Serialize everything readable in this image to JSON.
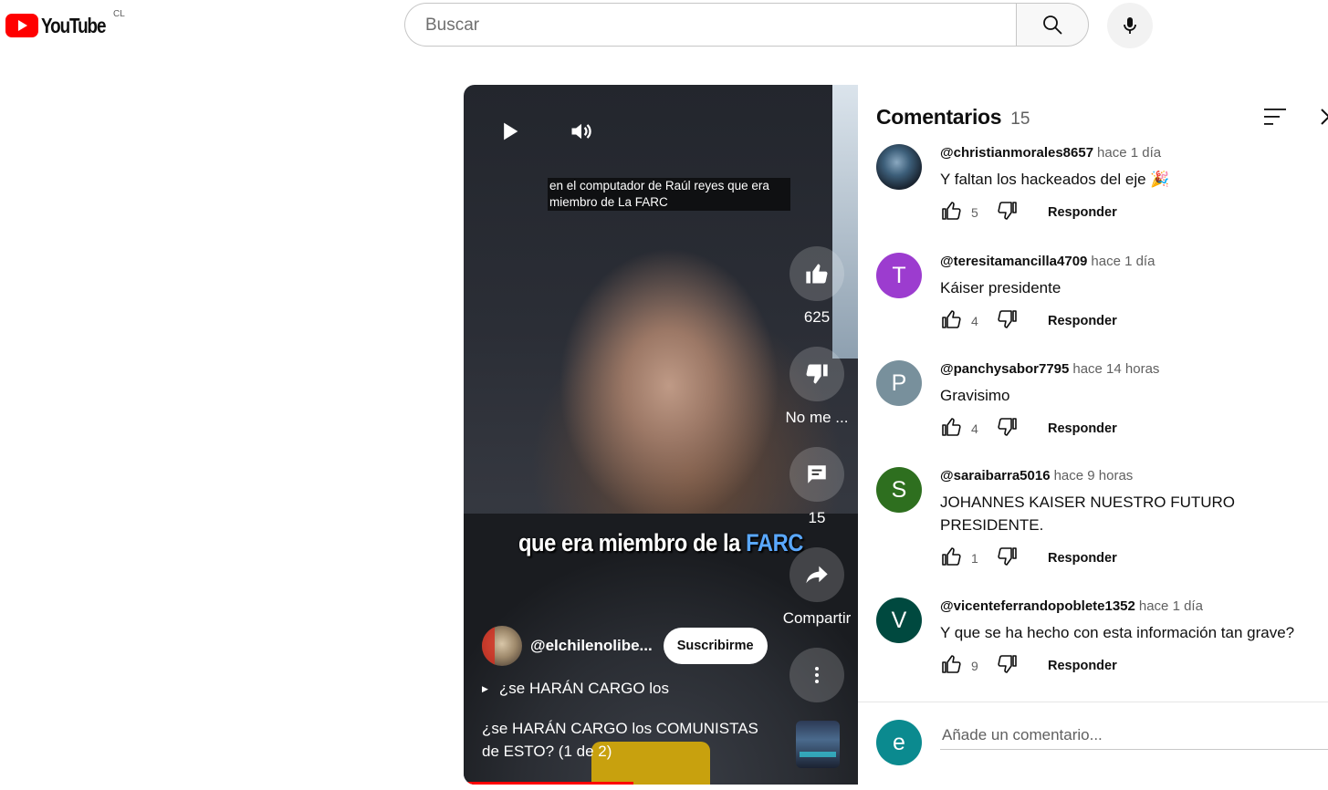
{
  "masthead": {
    "logo_text": "YouTube",
    "country_code": "CL",
    "search_placeholder": "Buscar",
    "search_icon": "search-icon",
    "mic_icon": "mic-icon"
  },
  "video": {
    "caption_small": "en el computador de Raúl reyes que era miembro de La FARC",
    "caption_big_prefix": "que era miembro de la ",
    "caption_big_highlight": "FARC",
    "like_count": "625",
    "dislike_label": "No me ...",
    "comment_count": "15",
    "share_label": "Compartir",
    "channel_handle": "@elchilenolibe...",
    "subscribe_label": "Suscribirme",
    "playlist_label": "¿se HARÁN CARGO los",
    "title": "¿se HARÁN CARGO los COMUNISTAS de ESTO? (1 de 2)",
    "progress_fraction": 0.43
  },
  "comments_panel": {
    "title": "Comentarios",
    "count": "15",
    "reply_label": "Responder",
    "add_placeholder": "Añade un comentario...",
    "user_initial": "e",
    "items": [
      {
        "author": "@christianmorales8657",
        "time": "hace 1 día",
        "text": "Y faltan los hackeados del eje 🎉",
        "likes": "5",
        "initial": "",
        "color": "#1b2633"
      },
      {
        "author": "@teresitamancilla4709",
        "time": "hace 1 día",
        "text": "Káiser presidente",
        "likes": "4",
        "initial": "T",
        "color": "#9c3ccf"
      },
      {
        "author": "@panchysabor7795",
        "time": "hace 14 horas",
        "text": "Gravisimo",
        "likes": "4",
        "initial": "P",
        "color": "#78909c"
      },
      {
        "author": "@saraibarra5016",
        "time": "hace 9 horas",
        "text": "JOHANNES KAISER NUESTRO FUTURO PRESIDENTE.",
        "likes": "1",
        "initial": "S",
        "color": "#2e6f1f"
      },
      {
        "author": "@vicenteferrandopoblete1352",
        "time": "hace 1 día",
        "text": "Y que se ha hecho con esta información tan grave?",
        "likes": "9",
        "initial": "V",
        "color": "#00493f"
      }
    ]
  }
}
